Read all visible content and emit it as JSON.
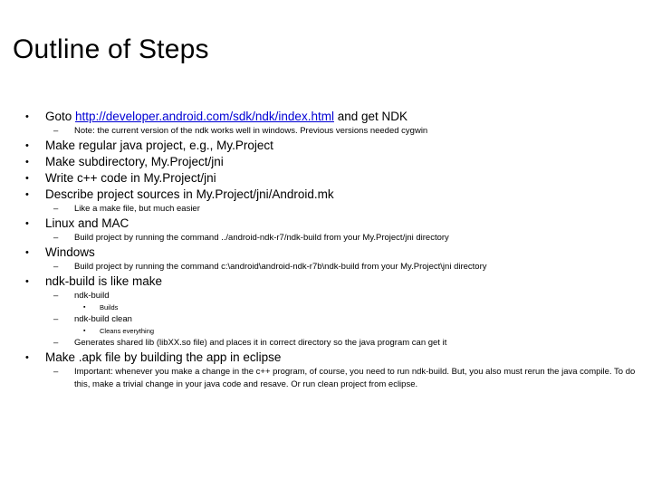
{
  "slide": {
    "title": "Outline of Steps",
    "items": [
      {
        "level": 1,
        "bullet": "•",
        "parts": [
          {
            "type": "text",
            "value": "Goto "
          },
          {
            "type": "link",
            "value": "http://developer.android.com/sdk/ndk/index.html"
          },
          {
            "type": "text",
            "value": " and get NDK"
          }
        ]
      },
      {
        "level": 2,
        "bullet": "–",
        "text": "Note: the current version of the ndk works well in windows. Previous versions needed cygwin"
      },
      {
        "level": 1,
        "bullet": "•",
        "text": "Make regular java project, e.g., My.Project"
      },
      {
        "level": 1,
        "bullet": "•",
        "text": "Make subdirectory, My.Project/jni"
      },
      {
        "level": 1,
        "bullet": "•",
        "text": "Write c++ code in My.Project/jni"
      },
      {
        "level": 1,
        "bullet": "•",
        "text": "Describe project sources in My.Project/jni/Android.mk"
      },
      {
        "level": 2,
        "bullet": "–",
        "text": "Like a make file, but much easier"
      },
      {
        "level": 1,
        "bullet": "•",
        "text": "Linux and MAC"
      },
      {
        "level": 2,
        "bullet": "–",
        "text": "Build project by running the command ../android-ndk-r7/ndk-build from your My.Project/jni directory"
      },
      {
        "level": 1,
        "bullet": "•",
        "text": "Windows"
      },
      {
        "level": 2,
        "bullet": "–",
        "text": "Build project by running the command c:\\android\\android-ndk-r7b\\ndk-build from your My.Project\\jni directory"
      },
      {
        "level": 1,
        "bullet": "•",
        "text": "ndk-build is like make"
      },
      {
        "level": 2,
        "bullet": "–",
        "text": "ndk-build"
      },
      {
        "level": 3,
        "bullet": "▪",
        "text": "Builds"
      },
      {
        "level": 2,
        "bullet": "–",
        "text": "ndk-build clean"
      },
      {
        "level": 3,
        "bullet": "▪",
        "text": "Cleans everything"
      },
      {
        "level": 2,
        "bullet": "–",
        "text": "Generates shared lib (libXX.so file) and places it in correct directory so the java program can get it"
      },
      {
        "level": 1,
        "bullet": "•",
        "text": "Make .apk file by building  the app in eclipse"
      },
      {
        "level": 2,
        "bullet": "–",
        "text": "Important: whenever you make a change in the c++ program, of course, you need to run ndk-build. But, you also must rerun the java compile. To do this, make a trivial change in your java code and resave. Or run clean project from eclipse."
      }
    ]
  }
}
